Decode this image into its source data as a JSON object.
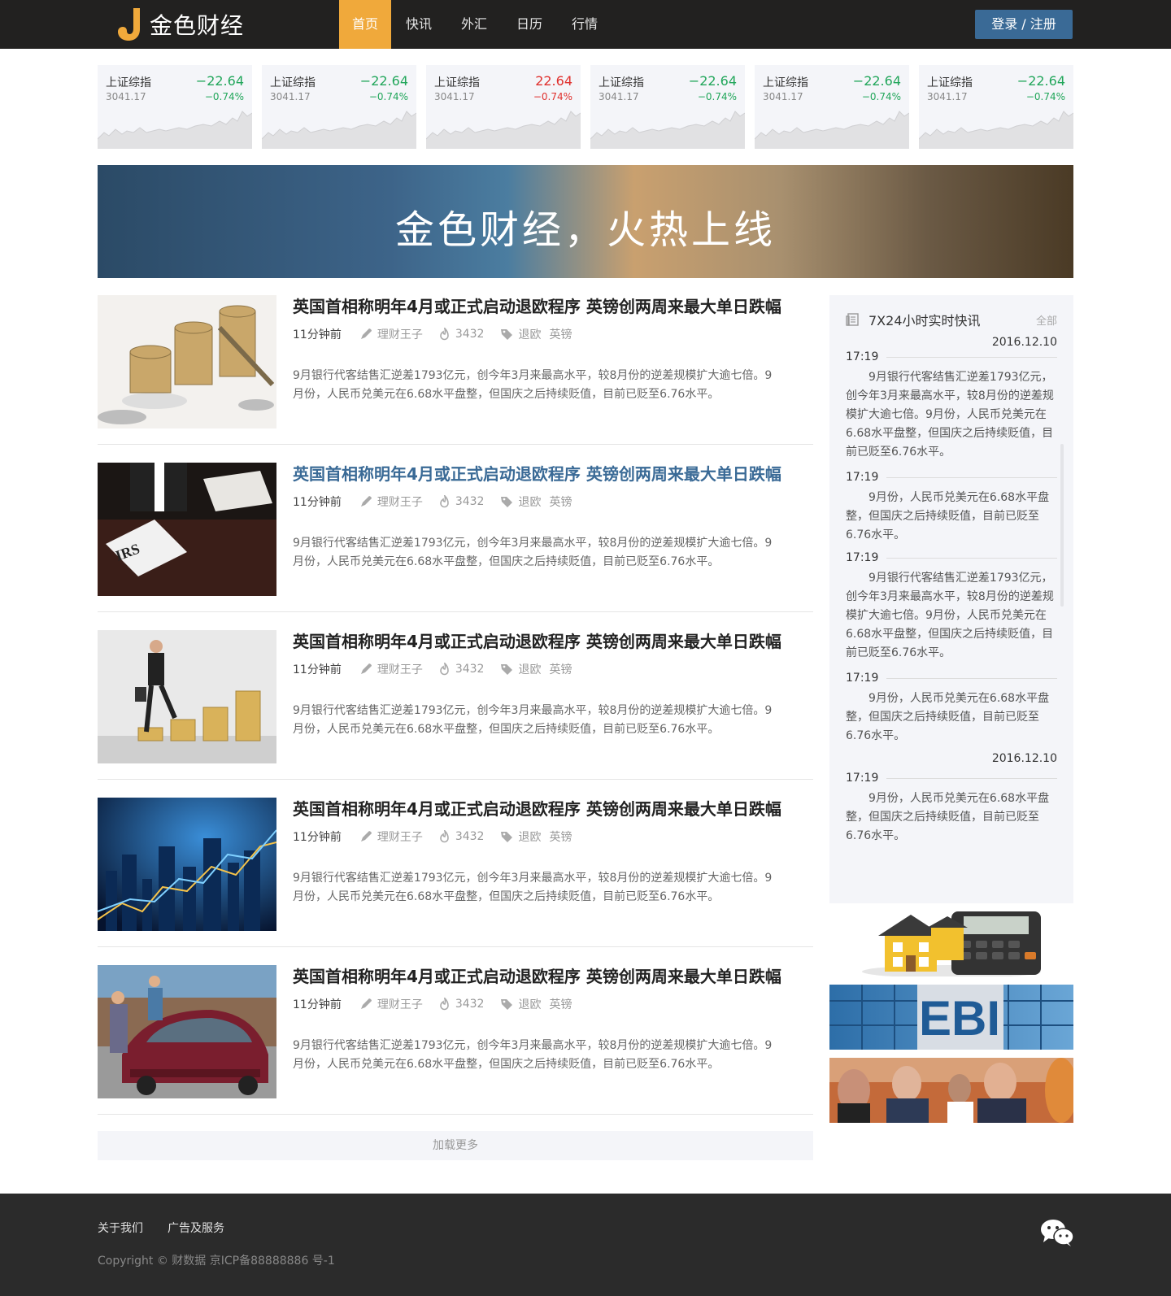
{
  "header": {
    "logo_text": "金色财经",
    "nav": [
      "首页",
      "快讯",
      "外汇",
      "日历",
      "行情"
    ],
    "login_label": "登录 / 注册"
  },
  "tickers": [
    {
      "name": "上证综指",
      "value": "3041.17",
      "change": "−22.64",
      "percent": "−0.74%",
      "direction": "down-green"
    },
    {
      "name": "上证综指",
      "value": "3041.17",
      "change": "−22.64",
      "percent": "−0.74%",
      "direction": "down-green"
    },
    {
      "name": "上证综指",
      "value": "3041.17",
      "change": "22.64",
      "percent": "−0.74%",
      "direction": "up-red"
    },
    {
      "name": "上证综指",
      "value": "3041.17",
      "change": "−22.64",
      "percent": "−0.74%",
      "direction": "down-green"
    },
    {
      "name": "上证综指",
      "value": "3041.17",
      "change": "−22.64",
      "percent": "−0.74%",
      "direction": "down-green"
    },
    {
      "name": "上证综指",
      "value": "3041.17",
      "change": "−22.64",
      "percent": "−0.74%",
      "direction": "down-green"
    }
  ],
  "colors": {
    "green": "#21a65a",
    "red": "#e0302d",
    "accent": "#f0a93b",
    "brand_blue": "#3a6a96"
  },
  "banner": {
    "text": "金色财经，火热上线"
  },
  "articles": [
    {
      "title": "英国首相称明年4月或正式启动退欧程序 英镑创两周来最大单日跌幅",
      "time": "11分钟前",
      "author": "理财王子",
      "views": "3432",
      "tags": [
        "退欧",
        "英镑"
      ],
      "desc": "9月银行代客结售汇逆差1793亿元，创今年3月来最高水平，较8月份的逆差规模扩大逾七倍。9月份，人民币兑美元在6.68水平盘整，但国庆之后持续贬值，目前已贬至6.76水平。",
      "image": "coins-photo"
    },
    {
      "title": "英国首相称明年4月或正式启动退欧程序 英镑创两周来最大单日跌幅",
      "time": "11分钟前",
      "author": "理财王子",
      "views": "3432",
      "tags": [
        "退欧",
        "英镑"
      ],
      "desc": "9月银行代客结售汇逆差1793亿元，创今年3月来最高水平，较8月份的逆差规模扩大逾七倍。9月份，人民币兑美元在6.68水平盘整，但国庆之后持续贬值，目前已贬至6.76水平。",
      "image": "irs-desk-photo",
      "irs_label": "IRS"
    },
    {
      "title": "英国首相称明年4月或正式启动退欧程序 英镑创两周来最大单日跌幅",
      "time": "11分钟前",
      "author": "理财王子",
      "views": "3432",
      "tags": [
        "退欧",
        "英镑"
      ],
      "desc": "9月银行代客结售汇逆差1793亿元，创今年3月来最高水平，较8月份的逆差规模扩大逾七倍。9月份，人民币兑美元在6.68水平盘整，但国庆之后持续贬值，目前已贬至6.76水平。",
      "image": "businessman-coins-photo"
    },
    {
      "title": "英国首相称明年4月或正式启动退欧程序 英镑创两周来最大单日跌幅",
      "time": "11分钟前",
      "author": "理财王子",
      "views": "3432",
      "tags": [
        "退欧",
        "英镑"
      ],
      "desc": "9月银行代客结售汇逆差1793亿元，创今年3月来最高水平，较8月份的逆差规模扩大逾七倍。9月份，人民币兑美元在6.68水平盘整，但国庆之后持续贬值，目前已贬至6.76水平。",
      "image": "city-chart-photo"
    },
    {
      "title": "英国首相称明年4月或正式启动退欧程序 英镑创两周来最大单日跌幅",
      "time": "11分钟前",
      "author": "理财王子",
      "views": "3432",
      "tags": [
        "退欧",
        "英镑"
      ],
      "desc": "9月银行代客结售汇逆差1793亿元，创今年3月来最高水平，较8月份的逆差规模扩大逾七倍。9月份，人民币兑美元在6.68水平盘整，但国庆之后持续贬值，目前已贬至6.76水平。",
      "image": "car-wash-photo"
    }
  ],
  "load_more": "加载更多",
  "sidebar": {
    "title": "7X24小时实时快讯",
    "all_label": "全部",
    "date1": "2016.12.10",
    "date2": "2016.12.10",
    "items": [
      {
        "time": "17:19",
        "text": "9月银行代客结售汇逆差1793亿元，创今年3月来最高水平，较8月份的逆差规模扩大逾七倍。9月份，人民币兑美元在6.68水平盘整，但国庆之后持续贬值，目前已贬至6.76水平。"
      },
      {
        "time": "17:19",
        "text": "9月份，人民币兑美元在6.68水平盘整，但国庆之后持续贬值，目前已贬至6.76水平。"
      },
      {
        "time": "17:19",
        "text": "9月银行代客结售汇逆差1793亿元，创今年3月来最高水平，较8月份的逆差规模扩大逾七倍。9月份，人民币兑美元在6.68水平盘整，但国庆之后持续贬值，目前已贬至6.76水平。"
      },
      {
        "time": "17:19",
        "text": "9月份，人民币兑美元在6.68水平盘整，但国庆之后持续贬值，目前已贬至6.76水平。"
      },
      {
        "time": "17:19",
        "text": "9月份，人民币兑美元在6.68水平盘整，但国庆之后持续贬值，目前已贬至6.76水平。"
      }
    ]
  },
  "ads": [
    "house-calculator-ad",
    "ebi-building-ad",
    "people-meeting-ad"
  ],
  "ad_ebi_label": "EBI",
  "footer": {
    "links": [
      "关于我们",
      "广告及服务"
    ],
    "copyright": "Copyright © 财数据   京ICP备88888886 号-1"
  }
}
